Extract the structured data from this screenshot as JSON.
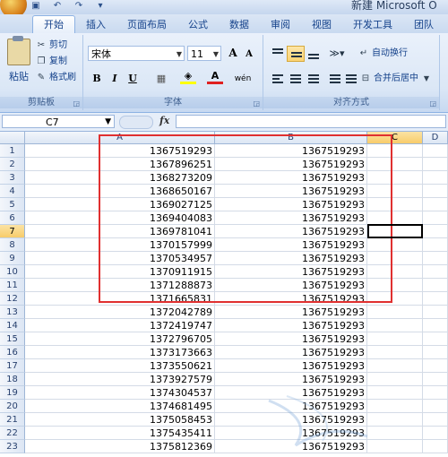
{
  "window": {
    "title": "新建 Microsoft O"
  },
  "qat": [
    {
      "name": "save-icon",
      "glyph": "▣"
    },
    {
      "name": "undo-icon",
      "glyph": "↶"
    },
    {
      "name": "redo-icon",
      "glyph": "↷"
    },
    {
      "name": "qat-customize-icon",
      "glyph": "▾"
    }
  ],
  "tabs": [
    "开始",
    "插入",
    "页面布局",
    "公式",
    "数据",
    "审阅",
    "视图",
    "开发工具",
    "团队"
  ],
  "ribbon": {
    "clipboard": {
      "label": "剪贴板",
      "paste": "粘贴",
      "cut": "剪切",
      "copy": "复制",
      "format_painter": "格式刷"
    },
    "font": {
      "label": "字体",
      "font_name": "宋体",
      "font_size": "11",
      "bold": "B",
      "italic": "I",
      "underline": "U",
      "grow": "A",
      "shrink": "A",
      "wen": "wén"
    },
    "alignment": {
      "label": "对齐方式",
      "wrap": "自动换行",
      "merge": "合并后居中"
    }
  },
  "formula_bar": {
    "name_box": "C7",
    "fx": "fx",
    "value": ""
  },
  "columns": [
    "A",
    "B",
    "C",
    "D"
  ],
  "rows": [
    {
      "n": "1",
      "a": "1367519293",
      "b": "1367519293"
    },
    {
      "n": "2",
      "a": "1367896251",
      "b": "1367519293"
    },
    {
      "n": "3",
      "a": "1368273209",
      "b": "1367519293"
    },
    {
      "n": "4",
      "a": "1368650167",
      "b": "1367519293"
    },
    {
      "n": "5",
      "a": "1369027125",
      "b": "1367519293"
    },
    {
      "n": "6",
      "a": "1369404083",
      "b": "1367519293"
    },
    {
      "n": "7",
      "a": "1369781041",
      "b": "1367519293"
    },
    {
      "n": "8",
      "a": "1370157999",
      "b": "1367519293"
    },
    {
      "n": "9",
      "a": "1370534957",
      "b": "1367519293"
    },
    {
      "n": "10",
      "a": "1370911915",
      "b": "1367519293"
    },
    {
      "n": "11",
      "a": "1371288873",
      "b": "1367519293"
    },
    {
      "n": "12",
      "a": "1371665831",
      "b": "1367519293"
    },
    {
      "n": "13",
      "a": "1372042789",
      "b": "1367519293"
    },
    {
      "n": "14",
      "a": "1372419747",
      "b": "1367519293"
    },
    {
      "n": "15",
      "a": "1372796705",
      "b": "1367519293"
    },
    {
      "n": "16",
      "a": "1373173663",
      "b": "1367519293"
    },
    {
      "n": "17",
      "a": "1373550621",
      "b": "1367519293"
    },
    {
      "n": "18",
      "a": "1373927579",
      "b": "1367519293"
    },
    {
      "n": "19",
      "a": "1374304537",
      "b": "1367519293"
    },
    {
      "n": "20",
      "a": "1374681495",
      "b": "1367519293"
    },
    {
      "n": "21",
      "a": "1375058453",
      "b": "1367519293"
    },
    {
      "n": "22",
      "a": "1375435411",
      "b": "1367519293"
    },
    {
      "n": "23",
      "a": "1375812369",
      "b": "1367519293"
    }
  ],
  "colors": {
    "highlight_box": "#e03030",
    "selected_header": "#f8cc6a",
    "ribbon_blue": "#dbe7f6"
  }
}
